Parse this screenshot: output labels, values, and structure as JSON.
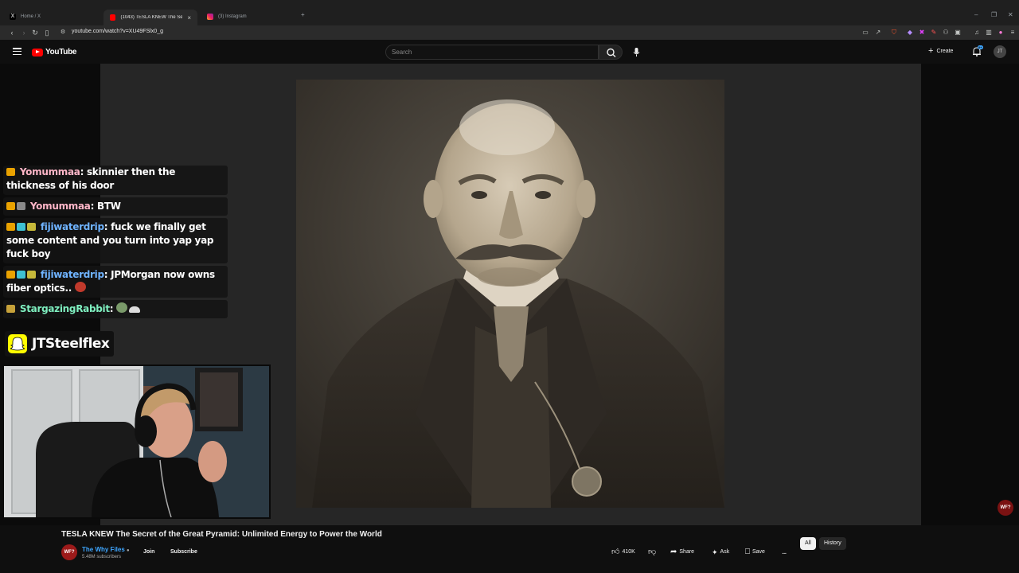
{
  "browser": {
    "tabs": [
      {
        "label": "Home / X",
        "favicon": "x-icon"
      },
      {
        "label": "(1043) TESLA KNEW The Secr",
        "favicon": "youtube-icon"
      },
      {
        "label": "(3) Instagram",
        "favicon": "instagram-icon"
      }
    ],
    "new_tab": "+",
    "url": "youtube.com/watch?v=XU49FSlx0_g"
  },
  "youtube": {
    "logo_text": "YouTube",
    "search_placeholder": "Search",
    "create_label": "Create",
    "notif_count": "9+",
    "avatar_initials": "JT"
  },
  "chat": {
    "messages": [
      {
        "user": "Yomummaa",
        "text": "skinnier then the thickness of his door",
        "user_class": "user-y"
      },
      {
        "user": "Yomummaa",
        "text": "BTW",
        "user_class": "user-y"
      },
      {
        "user": "fijiwaterdrip",
        "text": "fuck we finally get some content and you turn into yap yap fuck boy",
        "user_class": "user-f"
      },
      {
        "user": "fijiwaterdrip",
        "text": "JPMorgan now owns fiber optics..",
        "user_class": "user-f"
      },
      {
        "user": "StargazingRabbit",
        "text": "",
        "user_class": "user-s"
      }
    ]
  },
  "overlay": {
    "snapchat_name": "JTSteelflex",
    "corner_logo": "WF?"
  },
  "video": {
    "title": "TESLA KNEW The Secret of the Great Pyramid: Unlimited Energy to Power the World",
    "channel_logo": "WF?",
    "channel_name": "The Why Files",
    "subscribers": "5.48M subscribers",
    "join_label": "Join",
    "subscribe_label": "Subscribe",
    "likes": "410K",
    "share_label": "Share",
    "ask_label": "Ask",
    "save_label": "Save",
    "more_label": "...",
    "chips": [
      "All",
      "History"
    ]
  },
  "colors": {
    "youtube_red": "#ff0000",
    "link_blue": "#3ea6ff",
    "background": "#0f0f0f"
  }
}
